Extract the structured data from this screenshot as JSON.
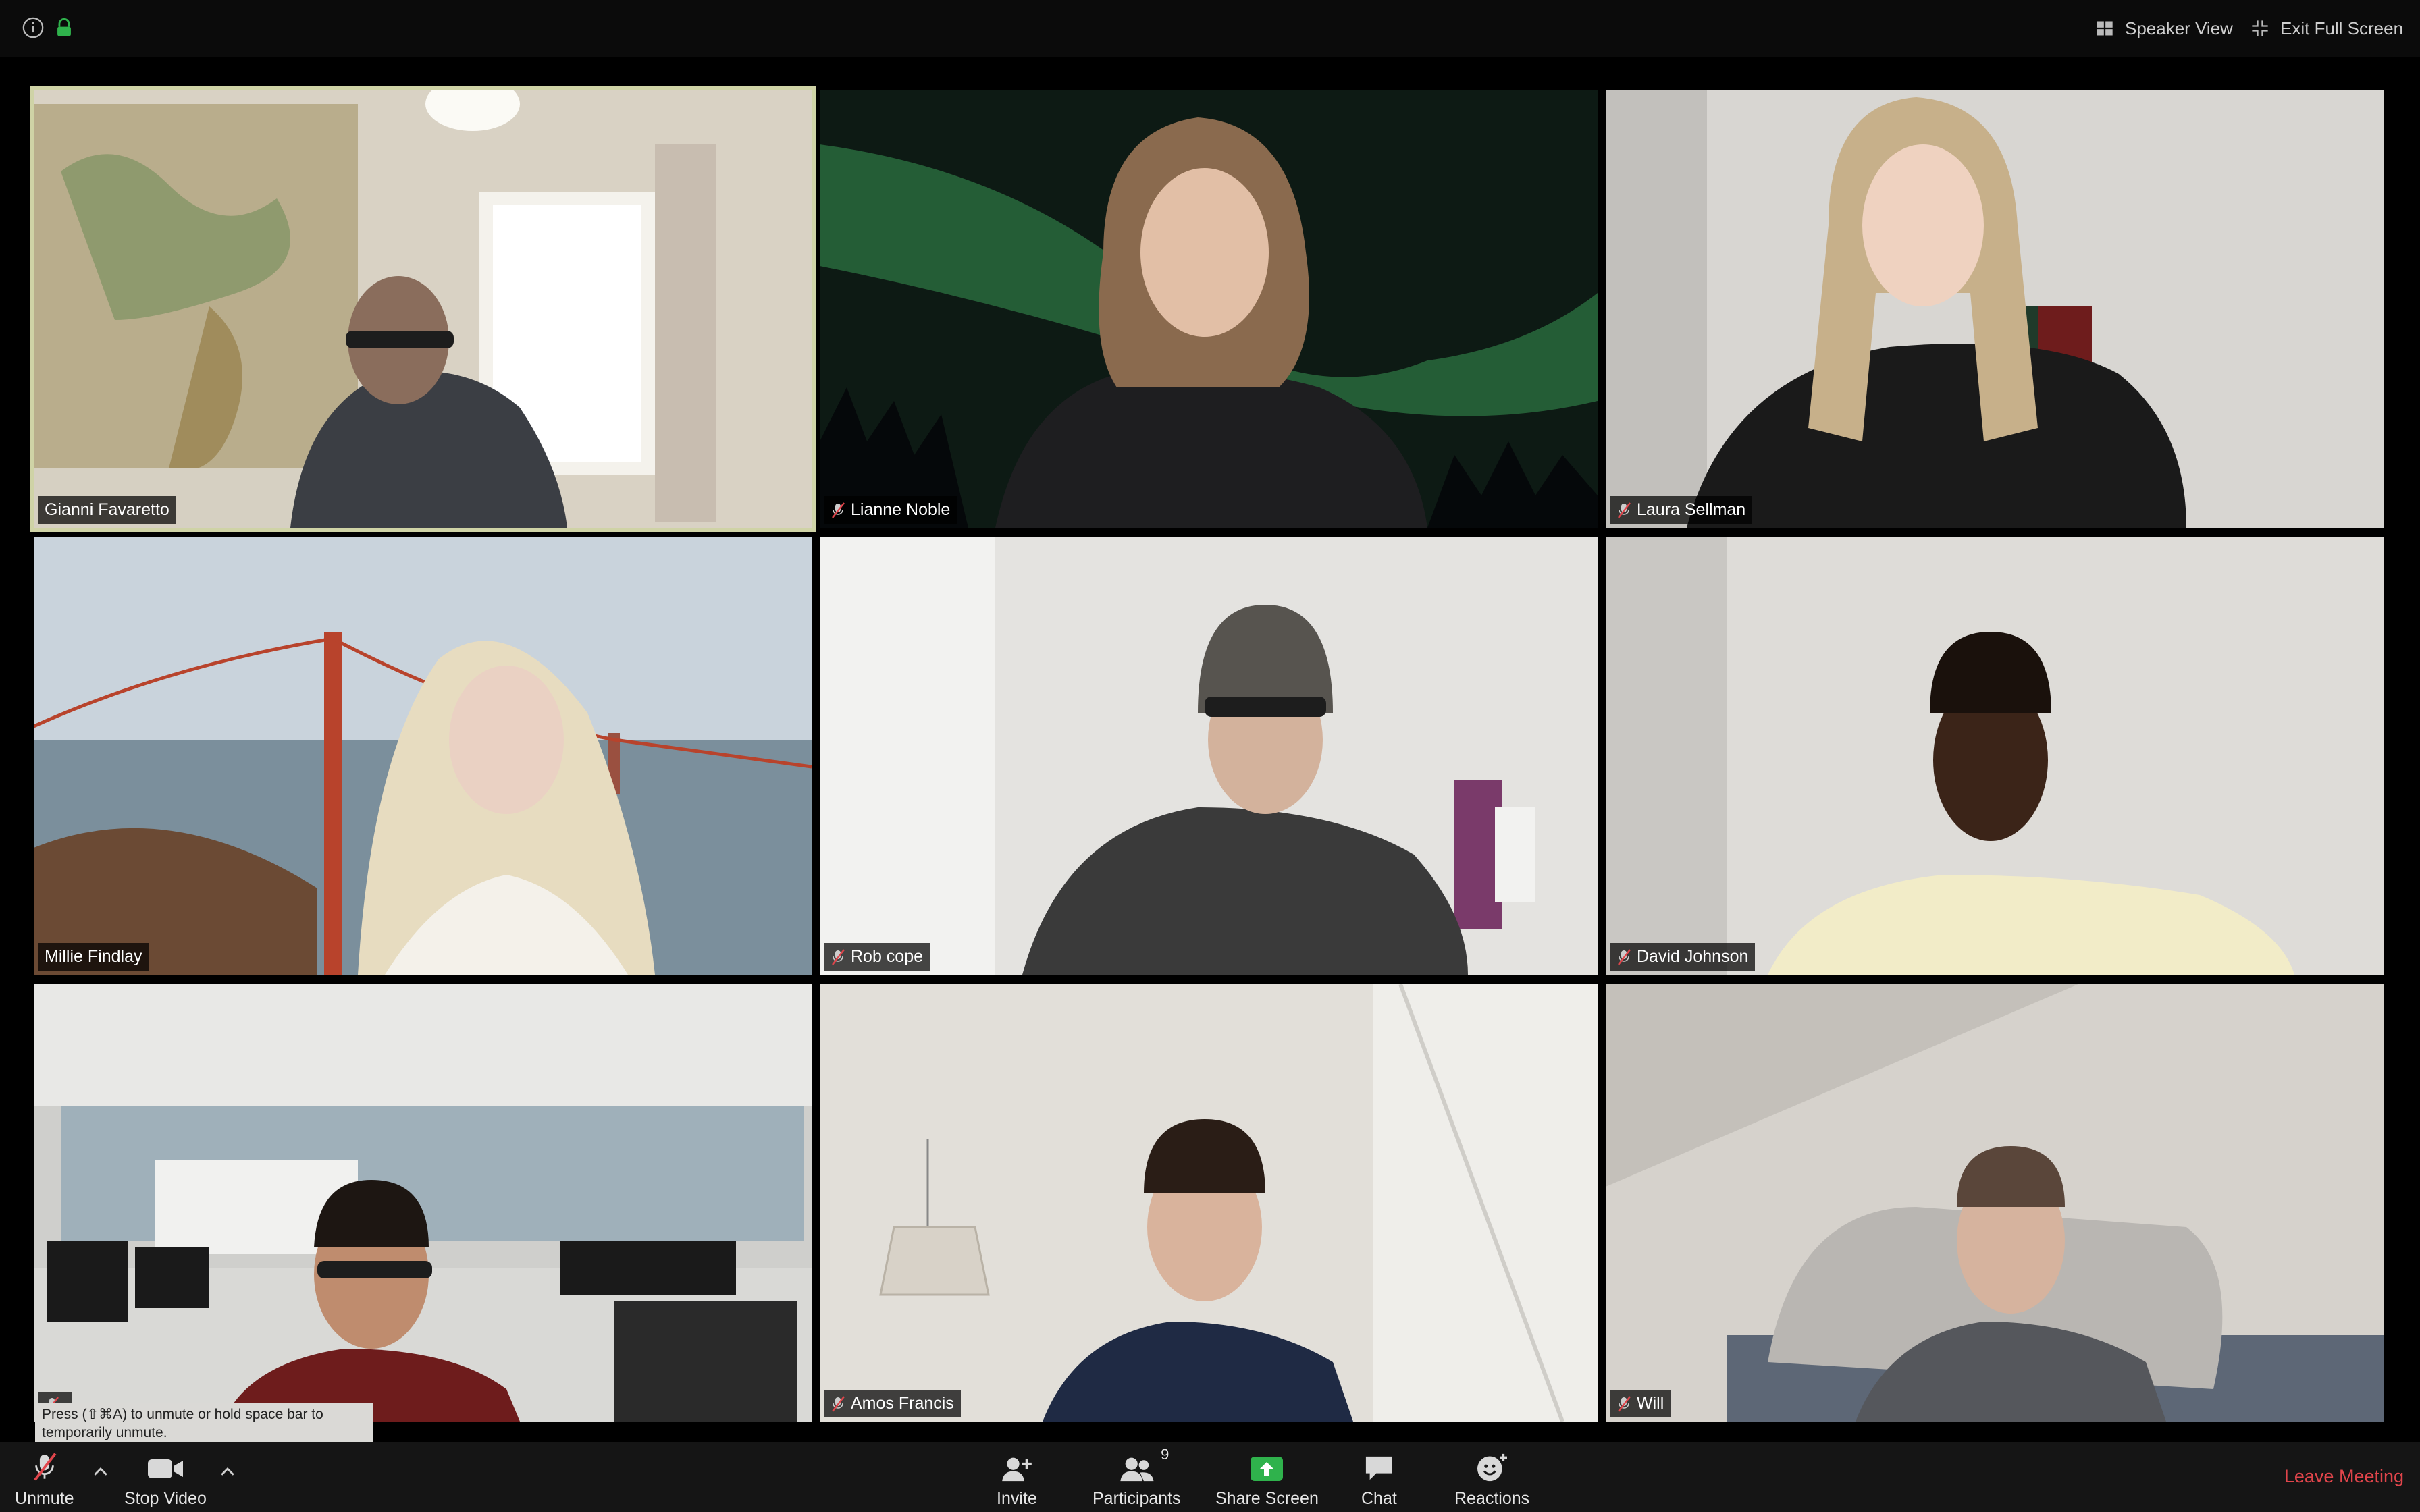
{
  "top_bar": {
    "speaker_view_label": "Speaker View",
    "exit_fullscreen_label": "Exit Full Screen",
    "icons": [
      "info-icon",
      "lock-icon",
      "grid-icon",
      "shrink-icon"
    ]
  },
  "participants": [
    {
      "name": "Gianni Favaretto",
      "muted": false,
      "active_speaker": true
    },
    {
      "name": "Lianne Noble",
      "muted": true,
      "active_speaker": false
    },
    {
      "name": "Laura Sellman",
      "muted": true,
      "active_speaker": false
    },
    {
      "name": "Millie Findlay",
      "muted": false,
      "active_speaker": false
    },
    {
      "name": "Rob cope",
      "muted": true,
      "active_speaker": false
    },
    {
      "name": "David Johnson",
      "muted": true,
      "active_speaker": false
    },
    {
      "name": "",
      "muted": true,
      "active_speaker": false
    },
    {
      "name": "Amos Francis",
      "muted": true,
      "active_speaker": false
    },
    {
      "name": "Will",
      "muted": true,
      "active_speaker": false
    }
  ],
  "tooltip": {
    "line1": "Press  (⇧⌘A) to unmute or hold space bar to",
    "line2": "temporarily unmute."
  },
  "toolbar": {
    "unmute_label": "Unmute",
    "stop_video_label": "Stop Video",
    "invite_label": "Invite",
    "participants_label": "Participants",
    "participants_count": "9",
    "share_screen_label": "Share Screen",
    "chat_label": "Chat",
    "reactions_label": "Reactions",
    "leave_label": "Leave Meeting"
  },
  "colors": {
    "active_speaker_border": "#cfd3a6",
    "share_screen_green": "#2fb24c",
    "leave_red": "#e0454b",
    "mute_red": "#e0454b"
  }
}
